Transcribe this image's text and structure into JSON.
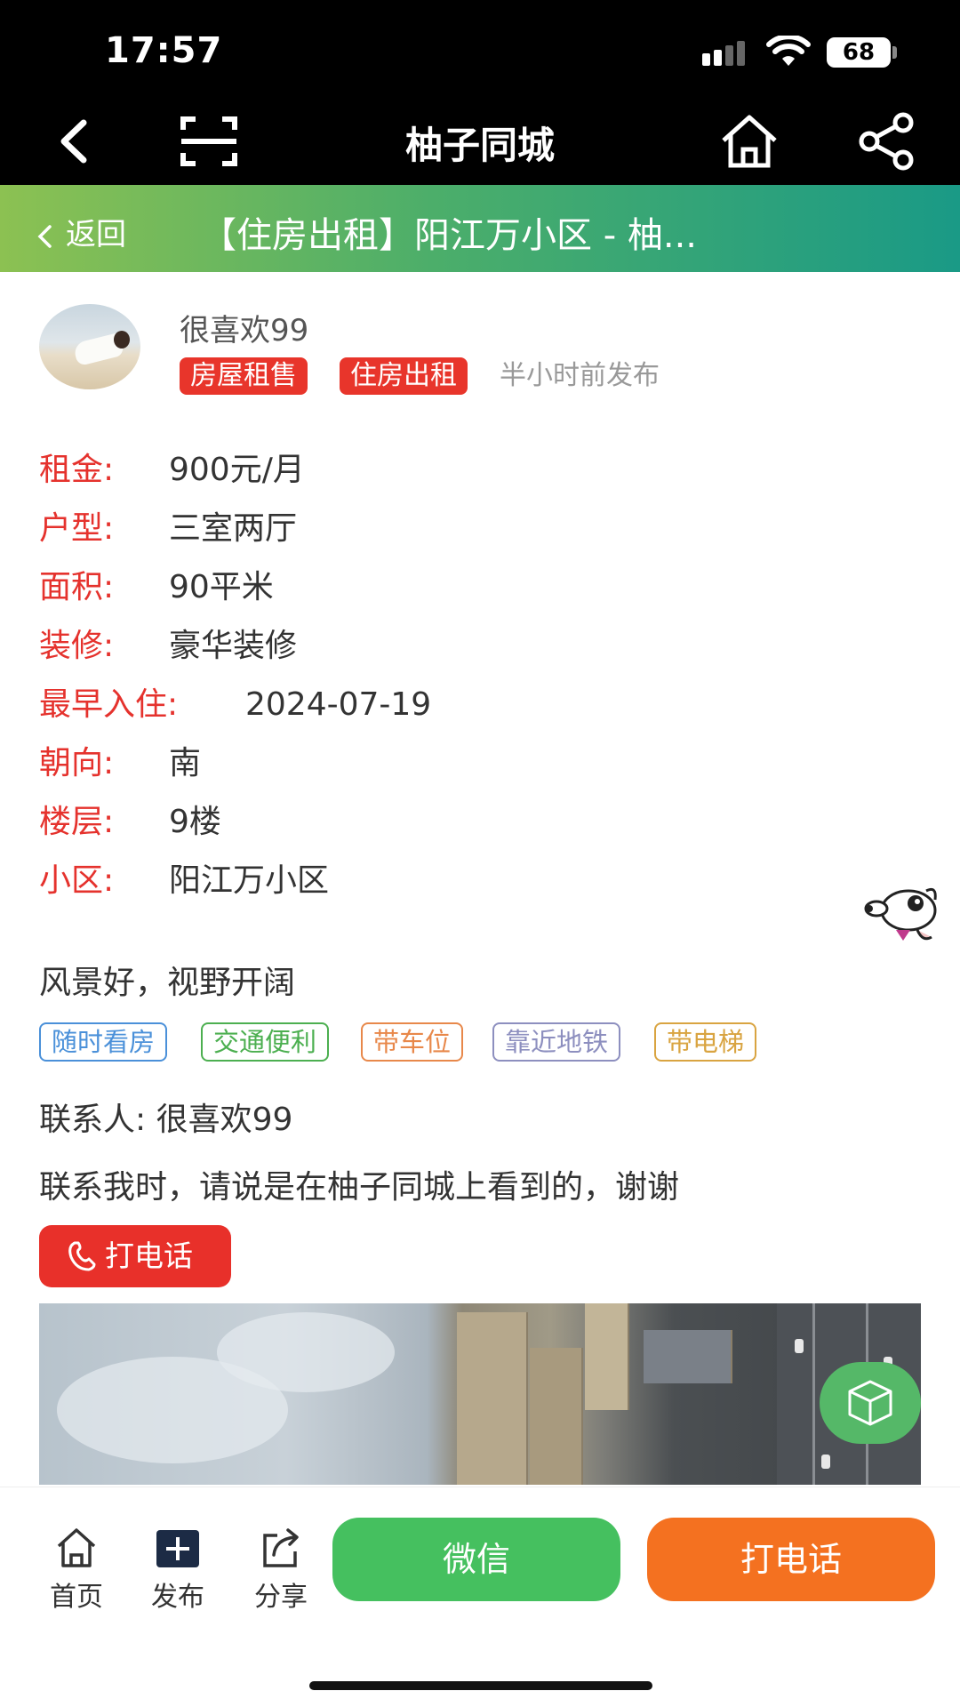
{
  "status_bar": {
    "time": "17:57",
    "battery": "68"
  },
  "app_header": {
    "title": "柚子同城"
  },
  "banner": {
    "back_label": "返回",
    "title": "【住房出租】阳江万小区 - 柚..."
  },
  "poster": {
    "name": "很喜欢99",
    "tags": [
      "房屋租售",
      "住房出租"
    ],
    "posted_time": "半小时前发布"
  },
  "details": [
    {
      "label": "租金:",
      "value": "900元/月"
    },
    {
      "label": "户型:",
      "value": "三室两厅"
    },
    {
      "label": "面积:",
      "value": "90平米"
    },
    {
      "label": "装修:",
      "value": "豪华装修"
    },
    {
      "label": "最早入住:",
      "value": "2024-07-19"
    },
    {
      "label": "朝向:",
      "value": "南"
    },
    {
      "label": "楼层:",
      "value": "9楼"
    },
    {
      "label": "小区:",
      "value": "阳江万小区"
    }
  ],
  "description": "风景好，视野开阔",
  "features": [
    {
      "label": "随时看房",
      "color": "#4a90d9"
    },
    {
      "label": "交通便利",
      "color": "#4caf50"
    },
    {
      "label": "带车位",
      "color": "#e8884a"
    },
    {
      "label": "靠近地铁",
      "color": "#8d8fbf"
    },
    {
      "label": "带电梯",
      "color": "#d9a441"
    }
  ],
  "contact": {
    "line": "联系人: 很喜欢99",
    "notice": "联系我时，请说是在柚子同城上看到的，谢谢",
    "call_label": "打电话"
  },
  "bottom_nav": {
    "home": "首页",
    "publish": "发布",
    "share": "分享",
    "wechat": "微信",
    "call": "打电话"
  },
  "colors": {
    "label_red": "#e5322d",
    "wechat_green": "#45c05f",
    "call_orange": "#f47120"
  }
}
